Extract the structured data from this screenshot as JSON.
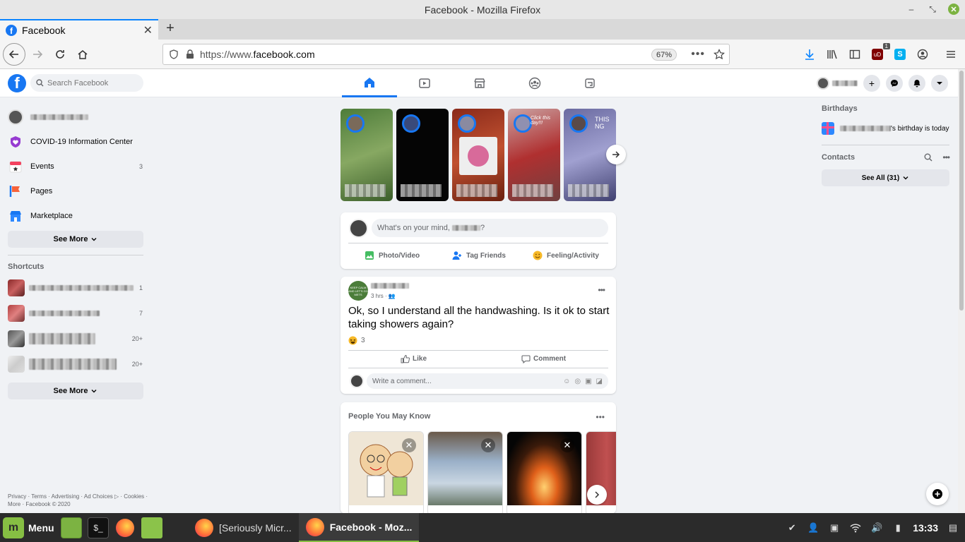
{
  "window": {
    "title": "Facebook - Mozilla Firefox"
  },
  "browser": {
    "tab_label": "Facebook",
    "url_prefix": "https://www.",
    "url_domain": "facebook.com",
    "zoom": "67%",
    "extension_badge": "1"
  },
  "fb": {
    "search_placeholder": "Search Facebook"
  },
  "left": {
    "items": [
      {
        "label": "COVID-19 Information Center",
        "count": ""
      },
      {
        "label": "Events",
        "count": "3"
      },
      {
        "label": "Pages",
        "count": ""
      },
      {
        "label": "Marketplace",
        "count": ""
      }
    ],
    "see_more": "See More",
    "shortcuts_title": "Shortcuts",
    "shortcut_counts": [
      "1",
      "7",
      "20+",
      "20+"
    ],
    "see_more_2": "See More",
    "footer": "Privacy · Terms · Advertising · Ad Choices ▷ · Cookies · More · Facebook © 2020"
  },
  "stories": [
    {
      "text": ""
    },
    {
      "text": ""
    },
    {
      "text": ""
    },
    {
      "text": "Click this day!!!"
    },
    {
      "text": "THIS NG"
    }
  ],
  "composer": {
    "placeholder_prefix": "What's on your mind, ",
    "placeholder_suffix": "?",
    "photo_video": "Photo/Video",
    "tag_friends": "Tag Friends",
    "feeling": "Feeling/Activity"
  },
  "post": {
    "avatar_text": "KEEP CALM AND LET'S GO METS",
    "time": "3 hrs ·",
    "text": "Ok, so I understand all the handwashing. Is it ok to start taking showers again?",
    "reactions": "3",
    "like": "Like",
    "comment": "Comment",
    "write_comment": "Write a comment..."
  },
  "pymk": {
    "title": "People You May Know"
  },
  "right": {
    "birthdays_title": "Birthdays",
    "birthday_text": "'s birthday is today",
    "contacts_title": "Contacts",
    "see_all": "See All (31)"
  },
  "taskbar": {
    "menu": "Menu",
    "task1": "[Seriously Micr...",
    "task2": "Facebook - Moz...",
    "clock": "13:33"
  },
  "colors": {
    "fb_blue": "#1877f2",
    "mint_green": "#86be43"
  }
}
